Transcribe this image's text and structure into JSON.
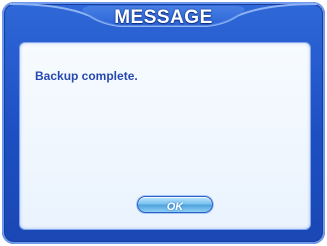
{
  "dialog": {
    "title": "MESSAGE",
    "message": "Backup complete.",
    "ok_label": "OK"
  },
  "colors": {
    "frame": "#1d4fc2",
    "title_tab": "#3a77e6",
    "panel": "#eef5fe",
    "message_text": "#2649b0",
    "button": "#7cc3ef"
  }
}
